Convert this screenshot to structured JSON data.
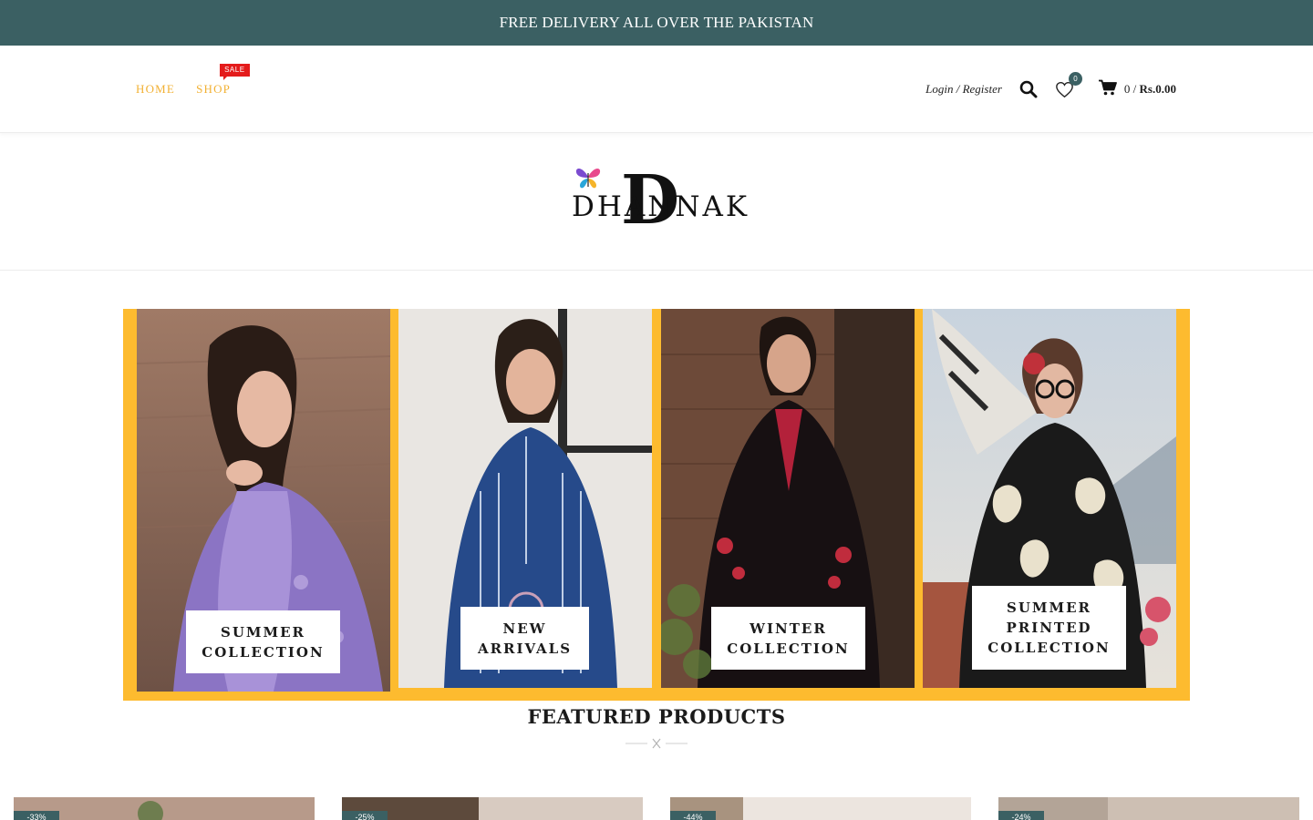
{
  "announcement": "FREE DELIVERY ALL OVER THE PAKISTAN",
  "nav": {
    "home": "HOME",
    "shop": "SHOP",
    "sale_badge": "SALE"
  },
  "header": {
    "login": "Login / Register",
    "wishlist_count": "0",
    "cart_count": "0 /",
    "cart_total": "Rs.0.00"
  },
  "logo": {
    "name": "DHANNAK",
    "mark": "D"
  },
  "collections": [
    {
      "label_line1": "SUMMER",
      "label_line2": "COLLECTION",
      "label_line3": ""
    },
    {
      "label_line1": "NEW",
      "label_line2": "ARRIVALS",
      "label_line3": ""
    },
    {
      "label_line1": "WINTER",
      "label_line2": "COLLECTION",
      "label_line3": ""
    },
    {
      "label_line1": "SUMMER",
      "label_line2": "PRINTED",
      "label_line3": "COLLECTION"
    }
  ],
  "featured_title": "FEATURED PRODUCTS",
  "products": [
    {
      "discount": "-33%"
    },
    {
      "discount": "-25%"
    },
    {
      "discount": "-44%"
    },
    {
      "discount": "-24%"
    }
  ],
  "colors": {
    "topbar": "#3b6063",
    "nav_accent": "#f2b134",
    "banner_frame": "#fdbb2f",
    "sale_badge": "#e41b1b"
  }
}
